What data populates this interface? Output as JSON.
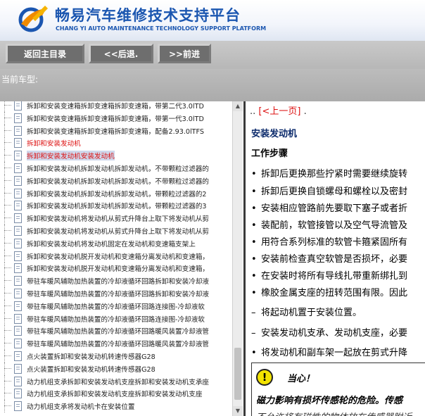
{
  "header": {
    "title": "畅易汽车维修技术支持平台",
    "subtitle": "CHANG YI AUTO MAINTENANCE TECHNOLOGY SUPPORT PLATFORM"
  },
  "toolbar": {
    "home_label": "返回主目录",
    "back_label": "<<后退.",
    "forward_label": ">>前进"
  },
  "cartype": {
    "label": "当前车型:"
  },
  "tree": {
    "items": [
      {
        "label": "拆卸和安装变速箱拆卸变速箱拆卸变速箱，带第二代3.0lTD",
        "state": "normal"
      },
      {
        "label": "拆卸和安装变速箱拆卸变速箱拆卸变速箱，带第一代3.0lTD",
        "state": "normal"
      },
      {
        "label": "拆卸和安装变速箱拆卸变速箱拆卸变速箱，配备2.93.0lTFS",
        "state": "normal"
      },
      {
        "label": "拆卸和安装发动机",
        "state": "red"
      },
      {
        "label": "拆卸和安装发动机安装发动机",
        "state": "sel"
      },
      {
        "label": "拆卸和安装发动机拆卸发动机拆卸发动机，不带颗粒过滤器的",
        "state": "normal"
      },
      {
        "label": "拆卸和安装发动机拆卸发动机拆卸发动机，不带颗粒过滤器的",
        "state": "normal"
      },
      {
        "label": "拆卸和安装发动机拆卸发动机拆卸发动机，带颗粒过滤器的2",
        "state": "normal"
      },
      {
        "label": "拆卸和安装发动机拆卸发动机拆卸发动机，带颗粒过滤器的3",
        "state": "normal"
      },
      {
        "label": "拆卸和安装发动机将发动机从剪式升降台上取下将发动机从剪",
        "state": "normal"
      },
      {
        "label": "拆卸和安装发动机将发动机从剪式升降台上取下将发动机从剪",
        "state": "normal"
      },
      {
        "label": "拆卸和安装发动机将发动机固定在发动机和变速箱支架上",
        "state": "normal"
      },
      {
        "label": "拆卸和安装发动机脱开发动机和变速箱分离发动机和变速箱，",
        "state": "normal"
      },
      {
        "label": "拆卸和安装发动机脱开发动机和变速箱分离发动机和变速箱，",
        "state": "normal"
      },
      {
        "label": "带驻车暖风辅助加热装置的冷却液循环回路拆卸和安装冷却液",
        "state": "normal"
      },
      {
        "label": "带驻车暖风辅助加热装置的冷却液循环回路拆卸和安装冷却液",
        "state": "normal"
      },
      {
        "label": "带驻车暖风辅助加热装置的冷却液循环回路连接图-冷却液软",
        "state": "normal"
      },
      {
        "label": "带驻车暖风辅助加热装置的冷却液循环回路连接图-冷却液软",
        "state": "normal"
      },
      {
        "label": "带驻车暖风辅助加热装置的冷却液循环回路暖风装置冷却液管",
        "state": "normal"
      },
      {
        "label": "带驻车暖风辅助加热装置的冷却液循环回路暖风装置冷却液管",
        "state": "normal"
      },
      {
        "label": "点火装置拆卸和安装发动机转速传感器G28",
        "state": "normal"
      },
      {
        "label": "点火装置拆卸和安装发动机转速传感器G28",
        "state": "normal"
      },
      {
        "label": "动力机组支承拆卸和安装发动机支座拆卸和安装发动机支承座",
        "state": "normal"
      },
      {
        "label": "动力机组支承拆卸和安装发动机支座拆卸和安装发动机支座",
        "state": "normal"
      },
      {
        "label": "动力机组支承将发动机卡在安装位置",
        "state": "normal"
      }
    ]
  },
  "content": {
    "prev_prefix": "..",
    "prev_link": "[<上一页]",
    "prev_suffix": ".",
    "heading": "安装发动机",
    "steps_title": "工作步骤",
    "bullets": [
      {
        "mark": "•",
        "text": "拆卸后更换那些拧紧时需要继续旋转"
      },
      {
        "mark": "•",
        "text": "拆卸后更换自锁螺母和螺栓以及密封"
      },
      {
        "mark": "•",
        "text": "安装相应管路前先要取下塞子或者折"
      },
      {
        "mark": "•",
        "text": "装配前，软管接管以及空气导流管及"
      },
      {
        "mark": "•",
        "text": "用符合系列标准的软管卡箍紧固所有"
      },
      {
        "mark": "•",
        "text": "安装前检查真空软管是否损坏，必要"
      },
      {
        "mark": "•",
        "text": "在安装时将所有导线扎带重新绑扎到"
      },
      {
        "mark": "•",
        "text": "橡胶金属支座的扭转范围有限。因此"
      },
      {
        "mark": "–",
        "text": "将起动机置于安装位置。"
      },
      {
        "mark": "–",
        "text": "安装发动机支承、发动机支座，必要"
      },
      {
        "mark": "•",
        "text": "将发动机和副车架一起放在剪式升降"
      }
    ],
    "caution_title": "当心！",
    "caution_text": "磁力影响有损坏传感轮的危险。传感",
    "caution_text2": "不允许将有磁性的物体放在传感器附近"
  }
}
